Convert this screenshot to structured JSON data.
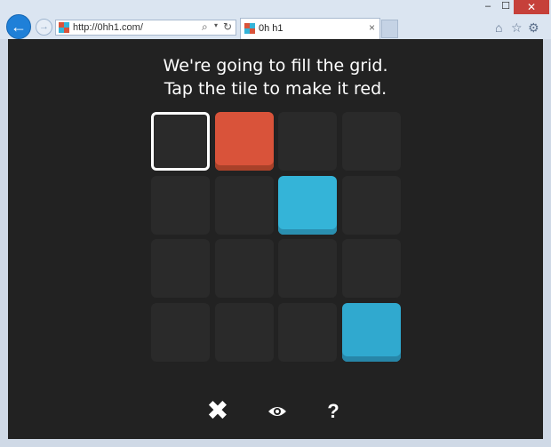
{
  "browser": {
    "url": "http://0hh1.com/",
    "tab_title": "0h h1",
    "back_glyph": "←",
    "forward_glyph": "→",
    "search_glyph": "⌕",
    "dropdown_glyph": "▾",
    "refresh_glyph": "↻",
    "tab_close_glyph": "×",
    "minimize_glyph": "–",
    "maximize_glyph": "☐",
    "close_glyph": "✕",
    "home_glyph": "⌂",
    "favorites_glyph": "☆",
    "settings_glyph": "⚙"
  },
  "game": {
    "instruction_line1": "We're going to fill the grid.",
    "instruction_line2": "Tap the tile to make it red.",
    "grid_size": 4,
    "cells": [
      [
        "selected",
        "red",
        "empty",
        "empty"
      ],
      [
        "empty",
        "empty",
        "blue",
        "empty"
      ],
      [
        "empty",
        "empty",
        "empty",
        "empty"
      ],
      [
        "empty",
        "empty",
        "empty",
        "blue"
      ]
    ],
    "colors": {
      "red": "#d9533a",
      "blue": "#34b4d8",
      "empty": "#2a2a2a",
      "background": "#222222"
    },
    "controls": {
      "close_glyph": "✖",
      "eye_glyph": "👁",
      "help_glyph": "?"
    }
  }
}
